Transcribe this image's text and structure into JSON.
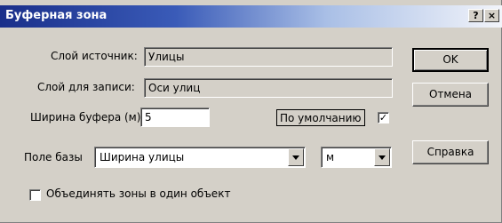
{
  "window": {
    "title": "Буферная зона",
    "help_glyph": "?",
    "close_glyph": "×"
  },
  "source_layer": {
    "label": "Слой источник:",
    "value": "Улицы"
  },
  "target_layer": {
    "label": "Слой для записи:",
    "value": "Оси улиц"
  },
  "buffer_width": {
    "label": "Ширина буфера (м)",
    "value": "5"
  },
  "default_option": {
    "label": "По умолчанию",
    "checked": true,
    "check_glyph": "✓"
  },
  "base_field": {
    "label": "Поле базы",
    "value": "Ширина улицы"
  },
  "unit": {
    "value": "м"
  },
  "merge_option": {
    "label": "Объединять зоны в один объект",
    "checked": false
  },
  "buttons": {
    "ok": "OK",
    "cancel": "Отмена",
    "help": "Справка"
  }
}
